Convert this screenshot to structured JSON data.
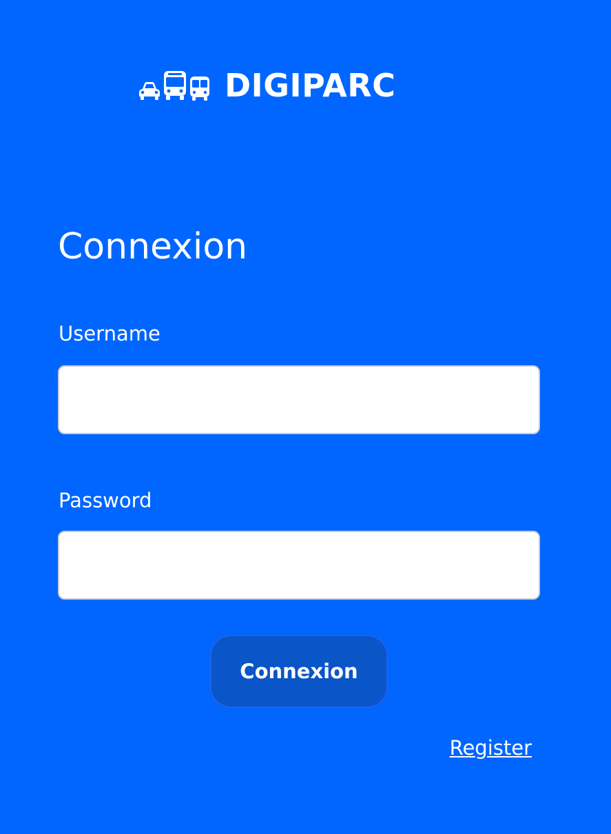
{
  "brand": {
    "name": "DIGIPARC",
    "icons": [
      "car-icon",
      "bus-icon",
      "tram-icon"
    ],
    "color": "#ffffff"
  },
  "login": {
    "title": "Connexion",
    "username_label": "Username",
    "username_value": "",
    "password_label": "Password",
    "password_value": "",
    "submit_label": "Connexion",
    "register_label": "Register"
  },
  "colors": {
    "background": "#0066ff",
    "button": "#0a55c8",
    "input_background": "#ffffff",
    "input_border": "#c9ccd2"
  }
}
